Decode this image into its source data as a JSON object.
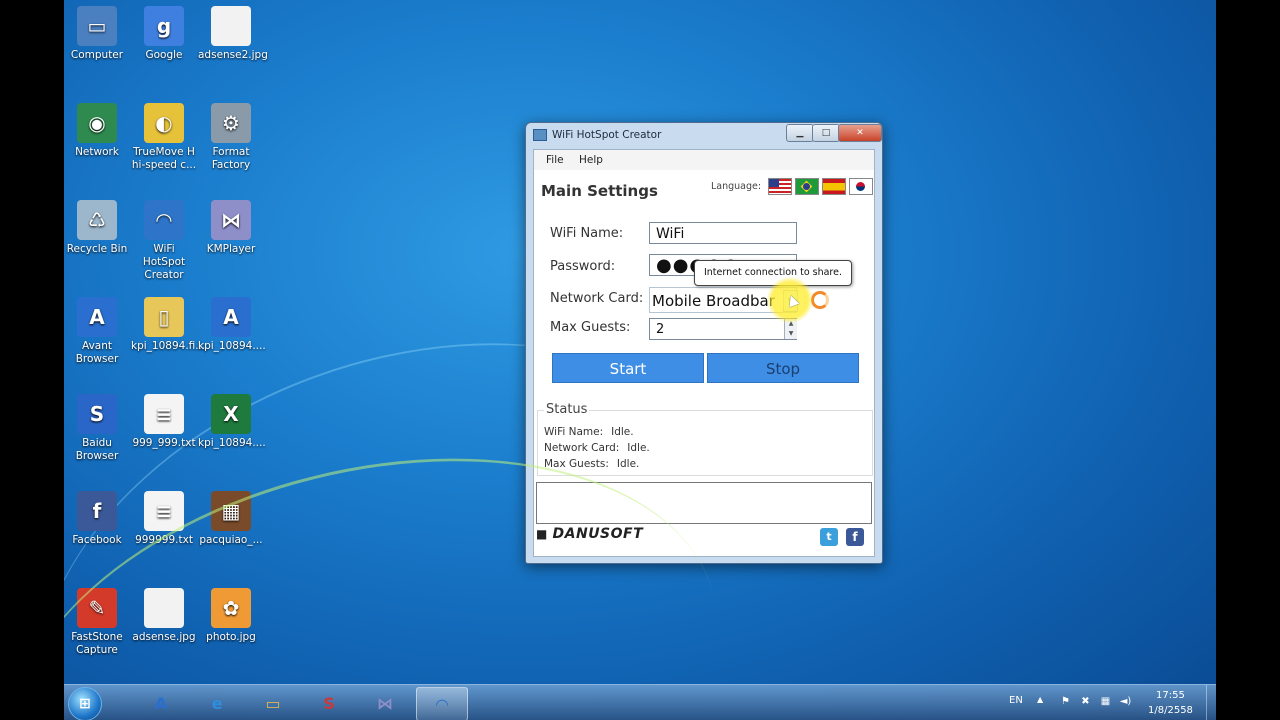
{
  "desktop": {
    "icons": [
      {
        "label": "Computer",
        "glyph": "▭",
        "color": "#4a7fc0"
      },
      {
        "label": "Google",
        "glyph": "g",
        "color": "#3f7fe0"
      },
      {
        "label": "adsense2.jpg",
        "glyph": "",
        "color": "#f2f2f2"
      },
      {
        "label": "Network",
        "glyph": "◉",
        "color": "#2f8a4f"
      },
      {
        "label": "TrueMove H hi-speed c...",
        "glyph": "◐",
        "color": "#e6c23a"
      },
      {
        "label": "Format Factory",
        "glyph": "⚙",
        "color": "#8a9aa8"
      },
      {
        "label": "Recycle Bin",
        "glyph": "♺",
        "color": "#9cb6cc"
      },
      {
        "label": "WiFi HotSpot Creator",
        "glyph": "◠",
        "color": "#2e74c8"
      },
      {
        "label": "KMPlayer",
        "glyph": "⋈",
        "color": "#8e8fc9"
      },
      {
        "label": "Avant Browser",
        "glyph": "A",
        "color": "#2a6fd0"
      },
      {
        "label": "kpi_10894.fi...",
        "glyph": "▯",
        "color": "#e7c65a"
      },
      {
        "label": "kpi_10894....",
        "glyph": "A",
        "color": "#2a6fd0"
      },
      {
        "label": "Baidu Browser",
        "glyph": "S",
        "color": "#2a66c8"
      },
      {
        "label": "999_999.txt",
        "glyph": "≡",
        "color": "#f4f4f4"
      },
      {
        "label": "kpi_10894....",
        "glyph": "X",
        "color": "#1f7a3d"
      },
      {
        "label": "Facebook",
        "glyph": "f",
        "color": "#3b5998"
      },
      {
        "label": "999999.txt",
        "glyph": "≡",
        "color": "#f4f4f4"
      },
      {
        "label": "pacquiao_...",
        "glyph": "▦",
        "color": "#7a4b2a"
      },
      {
        "label": "FastStone Capture",
        "glyph": "✎",
        "color": "#d33a2a"
      },
      {
        "label": "adsense.jpg",
        "glyph": "",
        "color": "#f2f2f2"
      },
      {
        "label": "photo.jpg",
        "glyph": "✿",
        "color": "#f09a36"
      }
    ]
  },
  "window": {
    "title": "WiFi HotSpot Creator",
    "min_label": "▁",
    "max_label": "□",
    "close_label": "✕",
    "menu": {
      "file": "File",
      "help": "Help"
    },
    "main_title": "Main Settings",
    "language_label": "Language:",
    "fields": {
      "wifi_label": "WiFi Name:",
      "wifi_value": "WiFi",
      "password_label": "Password:",
      "password_value": "●●●●●",
      "card_label": "Network Card:",
      "card_value": "Mobile Broadbar",
      "guests_label": "Max Guests:",
      "guests_value": "2"
    },
    "tooltip": "Internet connection to share.",
    "start_label": "Start",
    "stop_label": "Stop",
    "status": {
      "legend": "Status",
      "wifi_label": "WiFi Name:",
      "wifi_value": "Idle.",
      "card_label": "Network Card:",
      "card_value": "Idle.",
      "guests_label": "Max Guests:",
      "guests_value": "Idle."
    },
    "brand": "DANUSOFT",
    "twitter_glyph": "t",
    "facebook_glyph": "f"
  },
  "taskbar": {
    "start_glyph": "⊞",
    "buttons": [
      {
        "name": "avant-browser",
        "glyph": "A",
        "color": "#2a6fd0"
      },
      {
        "name": "internet-explorer",
        "glyph": "e",
        "color": "#2f8de0"
      },
      {
        "name": "file-explorer",
        "glyph": "▭",
        "color": "#e2b54a"
      },
      {
        "name": "baidu-browser",
        "glyph": "S",
        "color": "#c83a3a"
      },
      {
        "name": "kmplayer",
        "glyph": "⋈",
        "color": "#8e8fc9"
      },
      {
        "name": "wifi-hotspot",
        "glyph": "◠",
        "color": "#2e74c8"
      }
    ],
    "lang": "EN",
    "tray_arrow": "▲",
    "time": "17:55",
    "date": "1/8/2558"
  }
}
